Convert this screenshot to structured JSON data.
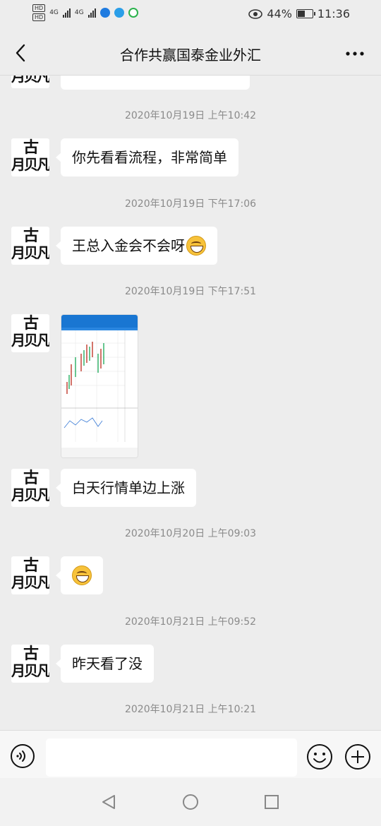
{
  "status_bar": {
    "left_indicators": [
      "HD",
      "HD",
      "4G",
      "4G"
    ],
    "battery_percent": "44%",
    "time": "11:36"
  },
  "header": {
    "title": "合作共赢国泰金业外汇",
    "back_icon": "chevron-left-icon",
    "more_icon": "more-dots-icon"
  },
  "messages": [
    {
      "type": "text",
      "text": "你先看看流程，非常简单"
    },
    {
      "type": "text",
      "text": "王总入金会不会呀"
    },
    {
      "type": "image",
      "description_icon": "chart-screenshot"
    },
    {
      "type": "text",
      "text": "白天行情单边上涨"
    },
    {
      "type": "emoji",
      "icon": "grin-emoji-icon"
    },
    {
      "type": "text",
      "text": "昨天看了没"
    }
  ],
  "timestamps": [
    "2020年10月19日 上午10:42",
    "2020年10月19日 下午17:06",
    "2020年10月19日 下午17:51",
    "2020年10月20日 上午09:03",
    "2020年10月21日 上午09:52",
    "2020年10月21日 上午10:21"
  ],
  "avatar": {
    "glyph_top": "古",
    "glyph_bottom": "月贝凡"
  },
  "input_bar": {
    "voice_icon": "voice-icon",
    "emoji_icon": "emoji-icon",
    "plus_icon": "plus-icon"
  },
  "nav_bar": {
    "icons": [
      "back-triangle-icon",
      "home-circle-icon",
      "recents-square-icon"
    ]
  },
  "colors": {
    "background": "#ededed",
    "bubble": "#ffffff",
    "timestamp": "#8a8a8a"
  }
}
